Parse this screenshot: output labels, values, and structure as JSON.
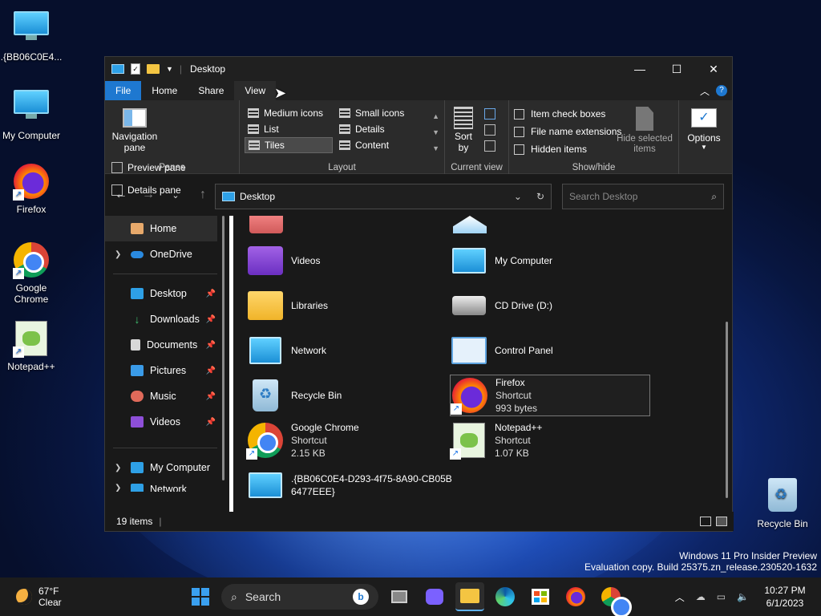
{
  "desktop": {
    "icons": [
      {
        "label": ".{BB06C0E4...",
        "icon": "monitor-check-icon"
      },
      {
        "label": "My Computer",
        "icon": "monitor-icon"
      },
      {
        "label": "Firefox",
        "icon": "firefox-icon"
      },
      {
        "label": "Google Chrome",
        "icon": "chrome-icon"
      },
      {
        "label": "Notepad++",
        "icon": "notepadpp-icon"
      },
      {
        "label": "Recycle Bin",
        "icon": "recycle-bin-icon"
      }
    ],
    "watermark_line1": "Windows 11 Pro Insider Preview",
    "watermark_line2": "Evaluation copy. Build 25375.zn_release.230520-1632"
  },
  "window": {
    "title": "Desktop",
    "controls": {
      "minimize": "—",
      "maximize": "☐",
      "close": "✕"
    },
    "tabs": [
      "File",
      "Home",
      "Share",
      "View"
    ],
    "active_tab": "View",
    "ribbon": {
      "panes": {
        "navigation_pane": "Navigation pane",
        "preview_pane": "Preview pane",
        "details_pane": "Details pane",
        "group_label": "Panes"
      },
      "layout": {
        "options": [
          "Medium icons",
          "Small icons",
          "List",
          "Details",
          "Tiles",
          "Content"
        ],
        "selected": "Tiles",
        "group_label": "Layout"
      },
      "current_view": {
        "sort_by": "Sort by",
        "group_label": "Current view"
      },
      "show_hide": {
        "item_check_boxes": "Item check boxes",
        "file_name_extensions": "File name extensions",
        "hidden_items": "Hidden items",
        "hide_selected_items": "Hide selected items",
        "group_label": "Show/hide"
      },
      "options": "Options"
    },
    "address": "Desktop",
    "search_placeholder": "Search Desktop",
    "sidebar": [
      {
        "label": "Home",
        "icon": "home-icon"
      },
      {
        "label": "OneDrive",
        "icon": "onedrive-icon"
      },
      {
        "label": "Desktop",
        "icon": "desktop-icon"
      },
      {
        "label": "Downloads",
        "icon": "download-icon"
      },
      {
        "label": "Documents",
        "icon": "documents-icon"
      },
      {
        "label": "Pictures",
        "icon": "pictures-icon"
      },
      {
        "label": "Music",
        "icon": "music-icon"
      },
      {
        "label": "Videos",
        "icon": "videos-icon"
      },
      {
        "label": "My Computer",
        "icon": "monitor-icon"
      },
      {
        "label": "Network",
        "icon": "network-icon"
      }
    ],
    "items": [
      {
        "name": "Videos",
        "line2": "",
        "line3": ""
      },
      {
        "name": "My Computer",
        "line2": "",
        "line3": ""
      },
      {
        "name": "Libraries",
        "line2": "",
        "line3": ""
      },
      {
        "name": "CD Drive (D:)",
        "line2": "",
        "line3": ""
      },
      {
        "name": "Network",
        "line2": "",
        "line3": ""
      },
      {
        "name": "Control Panel",
        "line2": "",
        "line3": ""
      },
      {
        "name": "Recycle Bin",
        "line2": "",
        "line3": ""
      },
      {
        "name": "Firefox",
        "line2": "Shortcut",
        "line3": "993 bytes"
      },
      {
        "name": "Google Chrome",
        "line2": "Shortcut",
        "line3": "2.15 KB"
      },
      {
        "name": "Notepad++",
        "line2": "Shortcut",
        "line3": "1.07 KB"
      },
      {
        "name": ".{BB06C0E4-D293-4f75-8A90-CB05B",
        "line2": "6477EEE}",
        "line3": ""
      }
    ],
    "status": "19 items"
  },
  "taskbar": {
    "weather_temp": "67°F",
    "weather_desc": "Clear",
    "search_label": "Search",
    "time": "10:27 PM",
    "date": "6/1/2023"
  }
}
